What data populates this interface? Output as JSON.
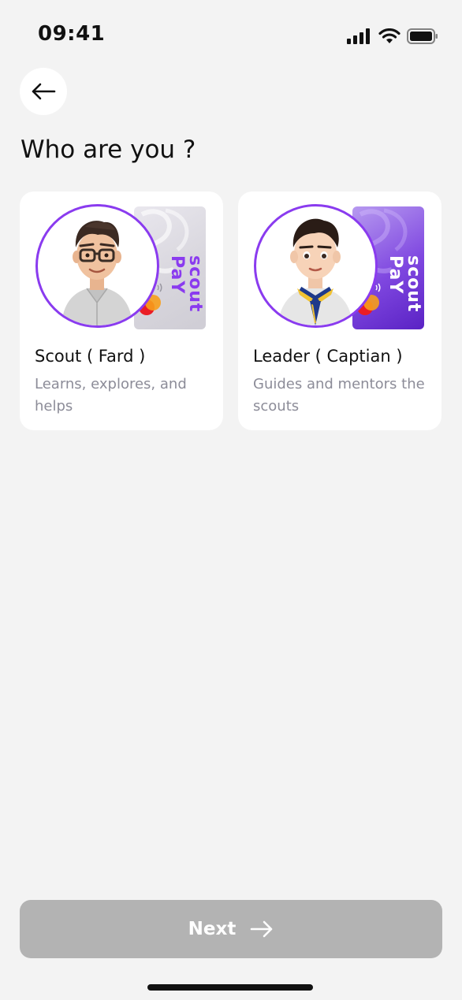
{
  "status_bar": {
    "time": "09:41",
    "icons": [
      "signal-icon",
      "wifi-icon",
      "battery-icon"
    ]
  },
  "header": {
    "back_icon": "arrow-left-icon",
    "title": "Who are you ?"
  },
  "cards": [
    {
      "name": "Scout ( Fard )",
      "description": "Learns, explores, and helps",
      "card_brand": "scout PaY",
      "card_style": "light"
    },
    {
      "name": "Leader ( Captian )",
      "description": "Guides and mentors the scouts",
      "card_brand": "scout PaY",
      "card_style": "purple"
    }
  ],
  "footer": {
    "next_label": "Next",
    "next_icon": "arrow-right-icon"
  },
  "colors": {
    "accent": "#8A3BEF",
    "disabled_button": "#B3B3B3",
    "background": "#F3F3F3"
  }
}
